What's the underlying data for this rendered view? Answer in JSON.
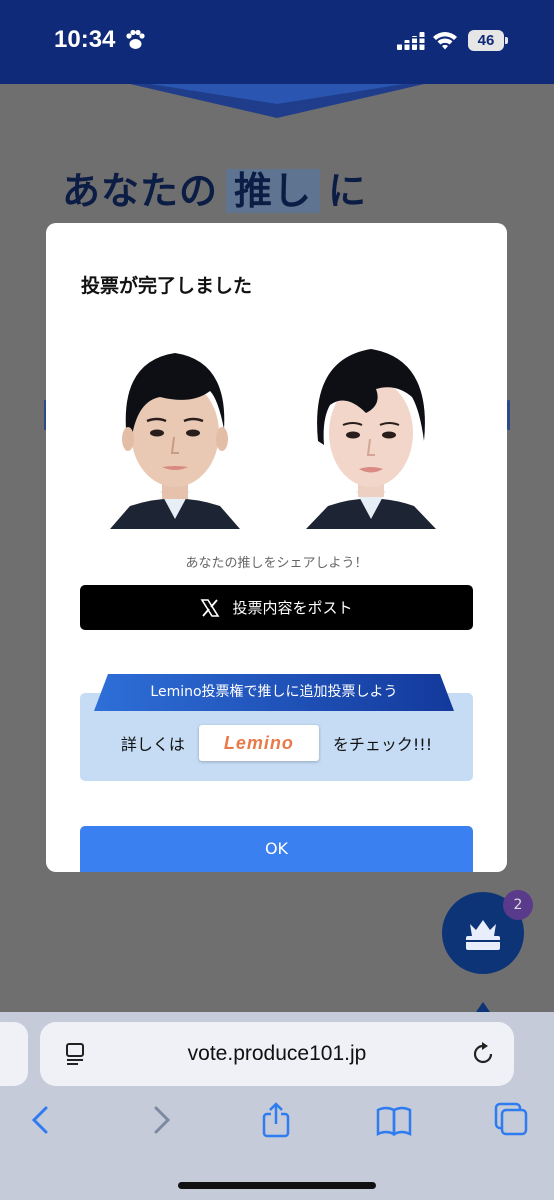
{
  "status_bar": {
    "time": "10:34",
    "battery": "46",
    "icons": [
      "paw-icon",
      "signal-icon",
      "wifi-icon",
      "battery-icon"
    ]
  },
  "page": {
    "heading_part1": "あなたの",
    "heading_highlight": "推し",
    "heading_part2": "に"
  },
  "modal": {
    "title": "投票が完了しました",
    "share_text": "あなたの推しをシェアしよう！",
    "post_button_label": "投票内容をポスト",
    "lemino": {
      "ribbon_text": "Lemino投票権で推しに追加投票しよう",
      "prefix": "詳しくは",
      "logo_text": "Lemino",
      "suffix": "をチェック!!!"
    },
    "ok_label": "OK"
  },
  "fab": {
    "badge_count": "2",
    "icon": "crown-box-icon"
  },
  "browser": {
    "url": "vote.produce101.jp",
    "toolbar_icons": [
      "back-icon",
      "forward-icon",
      "share-icon",
      "bookmarks-icon",
      "tabs-icon"
    ]
  },
  "colors": {
    "status_bar": "#0f2a78",
    "ok_button": "#3a80f0",
    "post_button": "#000000",
    "lemino_box": "#c6dcf5",
    "ribbon": "#1c4db5",
    "fab": "#0e3478",
    "browser_chrome": "#c5cbd9",
    "toolbar_icon": "#2f7bf0"
  }
}
